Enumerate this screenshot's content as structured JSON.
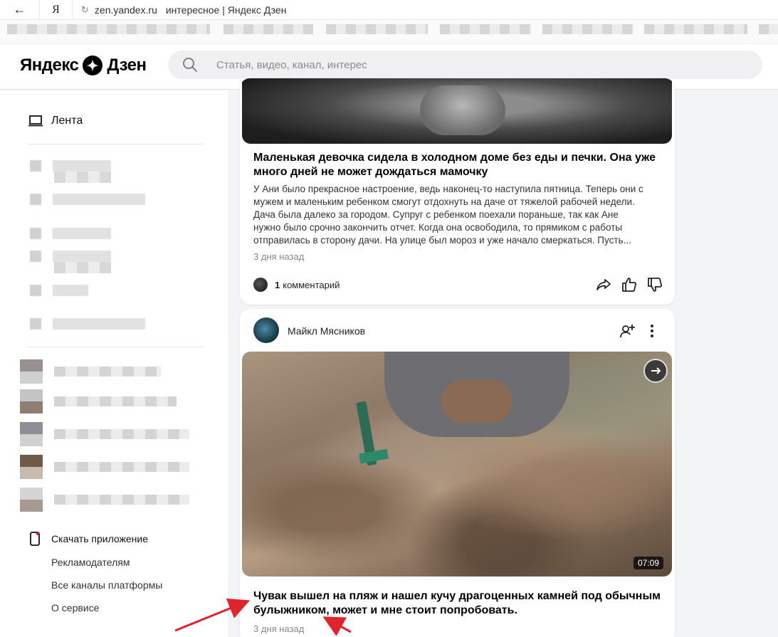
{
  "browser": {
    "back_glyph": "←",
    "ya_label": "Я",
    "reload_glyph": "↻",
    "url_host": "zen.yandex.ru",
    "tab_title": "интересное | Яндекс Дзен"
  },
  "header": {
    "logo_left": "Яндекс",
    "logo_right": "Дзен",
    "search_placeholder": "Статья, видео, канал, интерес"
  },
  "sidebar": {
    "feed_label": "Лента",
    "app_label": "Скачать приложение",
    "links": [
      "Рекламодателям",
      "Все каналы платформы",
      "О сервисе"
    ]
  },
  "card1": {
    "title_line1": "Маленькая девочка сидела в холодном доме без еды и печки. Она уже",
    "title_line2": "много дней не может дождаться мамочку",
    "text_lines": [
      "У Ани было прекрасное настроение, ведь наконец-то наступила пятница. Теперь они с",
      "мужем и маленьким ребенком смогут отдохнуть на даче от тяжелой рабочей недели.",
      "Дача была далеко за городом. Супруг с ребенком поехали пораньше, так как Ане",
      "нужно было срочно закончить отчет. Когда она освободила, то прямиком с работы",
      "отправилась в сторону дачи. На улице был мороз и уже начало смеркаться. Пусть..."
    ],
    "age": "3 дня назад",
    "comment_count": "1",
    "comment_label": "комментарий"
  },
  "card2": {
    "author": "Майкл Мясников",
    "duration": "07:09",
    "title_line1": "Чувак вышел на пляж и нашел кучу драгоценных камней под обычным",
    "title_line2": "булыжником, может и мне стоит попробовать.",
    "age": "3 дня назад"
  },
  "colors": {
    "annotation_arrow": "#e0242b",
    "accent": "#000000"
  }
}
